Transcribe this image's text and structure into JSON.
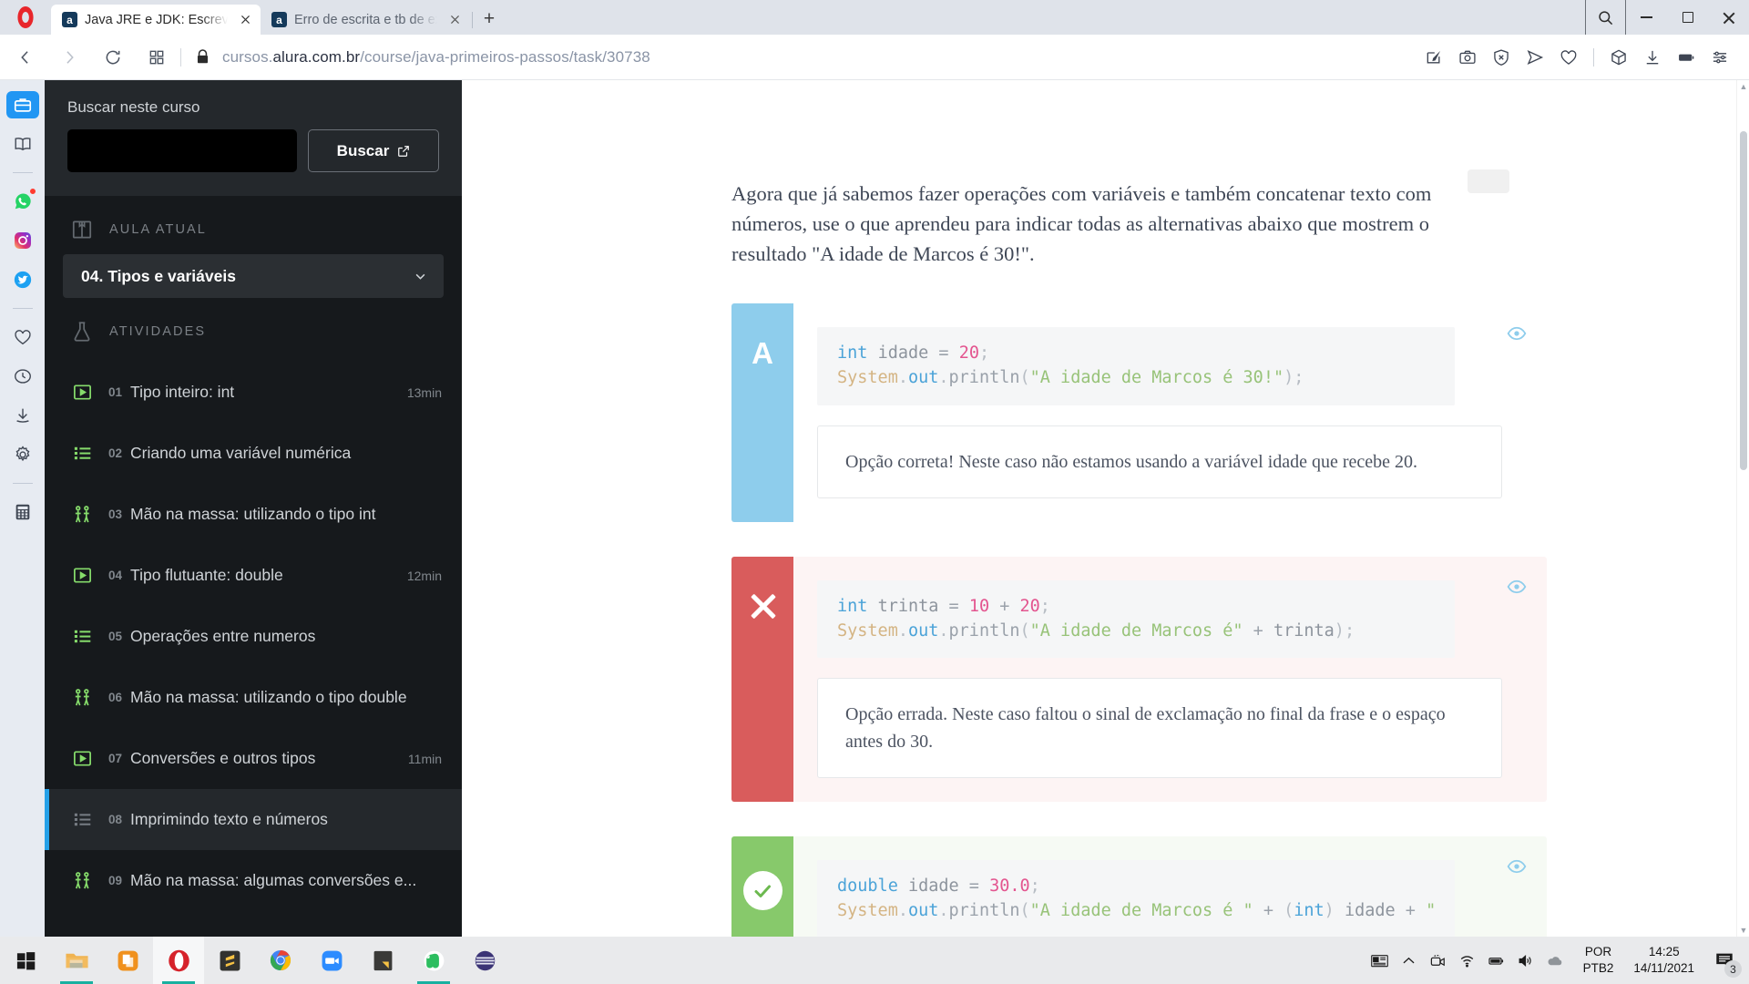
{
  "browser": {
    "name": "Opera",
    "tabs": [
      {
        "favicon_letter": "a",
        "title": "Java JRE e JDK: Escreva o se",
        "active": true
      },
      {
        "favicon_letter": "a",
        "title": "Erro de escrita e tb de exibi",
        "active": false
      }
    ],
    "new_tab_label": "+",
    "window_controls": {
      "search": "search-icon",
      "minimize": "–",
      "maximize": "□",
      "close": "✕"
    },
    "nav": {
      "back": "‹",
      "forward": "›",
      "reload": "↻",
      "tiles": "grid-icon"
    },
    "url_prefix": "cursos.",
    "url_domain": "alura.com.br",
    "url_path": "/course/java-primeiros-passos/task/30738",
    "address_icons": [
      "edit-page-icon",
      "camera-snapshot-icon",
      "ad-blocker-shield-icon",
      "send-flow-icon",
      "heart-icon",
      "cube-extensions-icon",
      "downloads-icon",
      "battery-saver-icon",
      "easy-setup-icon"
    ],
    "sidebar_rail": [
      {
        "name": "workspace-icon",
        "active": true
      },
      {
        "name": "reading-list-icon",
        "active": false
      },
      {
        "name": "whatsapp-icon",
        "active": false,
        "badge": true
      },
      {
        "name": "instagram-icon",
        "active": false
      },
      {
        "name": "twitter-icon",
        "active": false
      },
      {
        "name": "favorites-heart-icon",
        "active": false
      },
      {
        "name": "history-clock-icon",
        "active": false
      },
      {
        "name": "downloads-arrow-icon",
        "active": false
      },
      {
        "name": "settings-gear-icon",
        "active": false
      },
      {
        "name": "calculator-icon",
        "active": false
      }
    ]
  },
  "sidebar": {
    "search_label": "Buscar neste curso",
    "search_value": "",
    "search_placeholder": "",
    "search_button": "Buscar",
    "current_lesson_section": "AULA ATUAL",
    "current_lesson": "04. Tipos e variáveis",
    "activities_section": "ATIVIDADES",
    "activities": [
      {
        "num": "01",
        "title": "Tipo inteiro: int",
        "icon": "video-play-icon",
        "duration": "13min",
        "active": false
      },
      {
        "num": "02",
        "title": "Criando uma variável numérica",
        "icon": "list-exercise-icon",
        "duration": "",
        "active": false
      },
      {
        "num": "03",
        "title": "Mão na massa: utilizando o tipo int",
        "icon": "hands-on-icon",
        "duration": "",
        "active": false
      },
      {
        "num": "04",
        "title": "Tipo flutuante: double",
        "icon": "video-play-icon",
        "duration": "12min",
        "active": false
      },
      {
        "num": "05",
        "title": "Operações entre numeros",
        "icon": "list-exercise-icon",
        "duration": "",
        "active": false
      },
      {
        "num": "06",
        "title": "Mão na massa: utilizando o tipo double",
        "icon": "hands-on-icon",
        "duration": "",
        "active": false
      },
      {
        "num": "07",
        "title": "Conversões e outros tipos",
        "icon": "video-play-icon",
        "duration": "11min",
        "active": false
      },
      {
        "num": "08",
        "title": "Imprimindo texto e números",
        "icon": "list-exercise-icon",
        "duration": "",
        "active": true
      },
      {
        "num": "09",
        "title": "Mão na massa: algumas conversões e...",
        "icon": "hands-on-icon",
        "duration": "",
        "active": false
      }
    ]
  },
  "main": {
    "question": "Agora que já sabemos fazer operações com variáveis e também concatenar texto com números, use o que aprendeu para indicar todas as alternativas abaixo que mostrem o resultado \"A idade de Marcos é 30!\".",
    "alternatives": [
      {
        "marker": "A",
        "marker_type": "letter",
        "state": "neutral",
        "eye_icon": "eye-preview-icon",
        "code_line1_plain": "int idade = 20;",
        "code_line2_plain": "System.out.println(\"A idade de Marcos é 30!\");",
        "code": {
          "l1": {
            "type": "int",
            "sp1": " ",
            "id": "idade",
            "op": " = ",
            "num": "20",
            "semi": ";"
          },
          "l2": {
            "cls": "System",
            "dot1": ".",
            "mem": "out",
            "dot2": ".",
            "fn": "println",
            "open": "(",
            "str": "\"A idade de Marcos é 30!\"",
            "close": ")",
            "semi": ";"
          }
        },
        "feedback": "Opção correta! Neste caso não estamos usando a variável idade que recebe 20.",
        "has_scrollbar": false
      },
      {
        "marker": "✕",
        "marker_type": "x",
        "state": "wrong",
        "eye_icon": "eye-preview-icon",
        "code_line1_plain": "int trinta = 10 + 20;",
        "code_line2_plain": "System.out.println(\"A idade de Marcos é\" + trinta);",
        "code": {
          "l1": {
            "type": "int",
            "sp1": " ",
            "id": "trinta",
            "op": " = ",
            "num": "10",
            "plus": " + ",
            "num2": "20",
            "semi": ";"
          },
          "l2": {
            "cls": "System",
            "dot1": ".",
            "mem": "out",
            "dot2": ".",
            "fn": "println",
            "open": "(",
            "str": "\"A idade de Marcos é\"",
            "concat": " + ",
            "var": "trinta",
            "close": ")",
            "semi": ";"
          }
        },
        "feedback": "Opção errada. Neste caso faltou o sinal de exclamação no final da frase e o espaço antes do 30.",
        "has_scrollbar": false
      },
      {
        "marker": "✓",
        "marker_type": "check",
        "state": "right",
        "eye_icon": "eye-preview-icon",
        "code_line1_plain": "double idade = 30.0;",
        "code_line2_plain": "System.out.println(\"A idade de Marcos é \" + (int) idade + \"",
        "code": {
          "l1": {
            "type": "double",
            "sp1": " ",
            "id": "idade",
            "op": " = ",
            "num": "30.0",
            "semi": ";"
          },
          "l2": {
            "cls": "System",
            "dot1": ".",
            "mem": "out",
            "dot2": ".",
            "fn": "println",
            "open": "(",
            "str": "\"A idade de Marcos é \"",
            "concat": " + ",
            "cast_open": "(",
            "cast": "int",
            "cast_close": ") ",
            "var": "idade",
            "concat2": " + ",
            "str2": "\""
          }
        },
        "feedback": "",
        "has_scrollbar": true,
        "scroll_left_arrow": "‹",
        "scroll_right_arrow": "›"
      }
    ]
  },
  "taskbar": {
    "items": [
      {
        "name": "start-button",
        "active": false,
        "running": false
      },
      {
        "name": "file-explorer",
        "active": false,
        "running": true
      },
      {
        "name": "office-app",
        "active": false,
        "running": false
      },
      {
        "name": "opera-browser",
        "active": true,
        "running": true
      },
      {
        "name": "sublime-text",
        "active": false,
        "running": false
      },
      {
        "name": "google-chrome",
        "active": false,
        "running": false
      },
      {
        "name": "zoom-meetings",
        "active": false,
        "running": false
      },
      {
        "name": "sticky-notes",
        "active": false,
        "running": true
      },
      {
        "name": "evernote",
        "active": false,
        "running": true
      },
      {
        "name": "media-player",
        "active": false,
        "running": false
      }
    ],
    "tray_icons": [
      "news-weather-icon",
      "show-hidden-chevron-icon",
      "screen-recorder-icon",
      "wifi-icon",
      "battery-icon",
      "volume-icon",
      "onedrive-cloud-icon"
    ],
    "language_top": "POR",
    "language_bottom": "PTB2",
    "time": "14:25",
    "date": "14/11/2021",
    "notifications_count": "3"
  }
}
